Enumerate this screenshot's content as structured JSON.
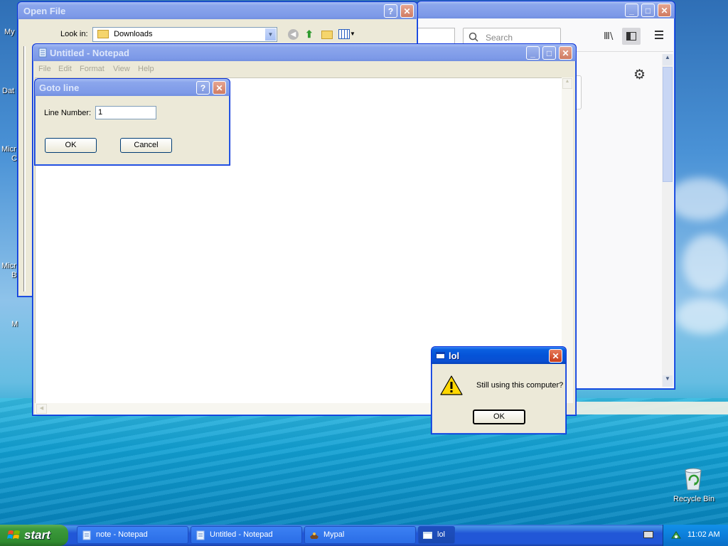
{
  "desktop": {
    "labels": [
      "My",
      "Dat",
      "Micr",
      "C",
      "Micr",
      "B",
      "M"
    ],
    "recycle_bin": "Recycle Bin"
  },
  "open_file": {
    "title": "Open File",
    "look_in_label": "Look in:",
    "look_in_value": "Downloads"
  },
  "browser": {
    "search_placeholder": "Search"
  },
  "notepad": {
    "title": "Untitled - Notepad",
    "menu": [
      "File",
      "Edit",
      "Format",
      "View",
      "Help"
    ]
  },
  "goto": {
    "title": "Goto line",
    "line_label": "Line Number:",
    "line_value": "1",
    "ok": "OK",
    "cancel": "Cancel"
  },
  "lol": {
    "title": "lol",
    "message": "Still using this computer?",
    "ok": "OK"
  },
  "taskbar": {
    "start": "start",
    "tasks": [
      "note - Notepad",
      "Untitled - Notepad",
      "Mypal",
      "lol"
    ],
    "clock": "11:02 AM"
  }
}
